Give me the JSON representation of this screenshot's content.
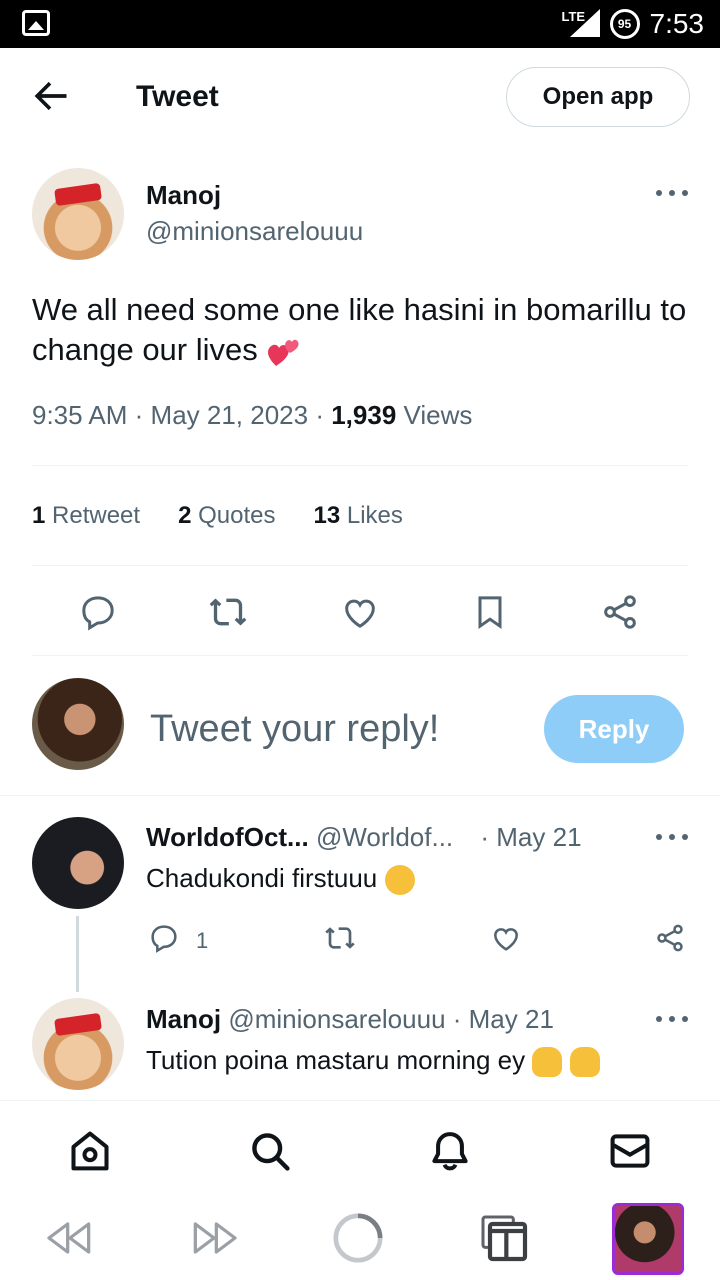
{
  "status_bar": {
    "network": "LTE",
    "battery": "95",
    "time": "7:53"
  },
  "header": {
    "title": "Tweet",
    "open_app_label": "Open app"
  },
  "tweet": {
    "name": "Manoj",
    "handle": "@minionsarelouuu",
    "text": "We all need some one like hasini in bomarillu to change our lives",
    "time": "9:35 AM",
    "date": "May 21, 2023",
    "views_count": "1,939",
    "views_label": "Views",
    "retweets_count": "1",
    "retweets_label": "Retweet",
    "quotes_count": "2",
    "quotes_label": "Quotes",
    "likes_count": "13",
    "likes_label": "Likes"
  },
  "composer": {
    "placeholder": "Tweet your reply!",
    "reply_label": "Reply"
  },
  "replies": [
    {
      "name": "WorldofOct...",
      "handle": "@Worldof...",
      "date": "· May 21",
      "text": "Chadukondi firstuuu",
      "reply_count": "1"
    },
    {
      "name": "Manoj",
      "handle": "@minionsarelouuu",
      "date": "· May 21",
      "text": "Tution poina mastaru morning ey"
    }
  ],
  "colors": {
    "accent": "#1d9bf0",
    "reply_button": "#8ecdf8",
    "secondary_text": "#536471",
    "browser_thumb_border": "#9c2bd6"
  },
  "icons": {
    "bottom_nav": [
      "home-icon",
      "search-icon",
      "notifications-icon",
      "messages-icon"
    ],
    "browser": [
      "back-icon",
      "forward-icon",
      "reload-icon",
      "tabs-icon"
    ]
  }
}
